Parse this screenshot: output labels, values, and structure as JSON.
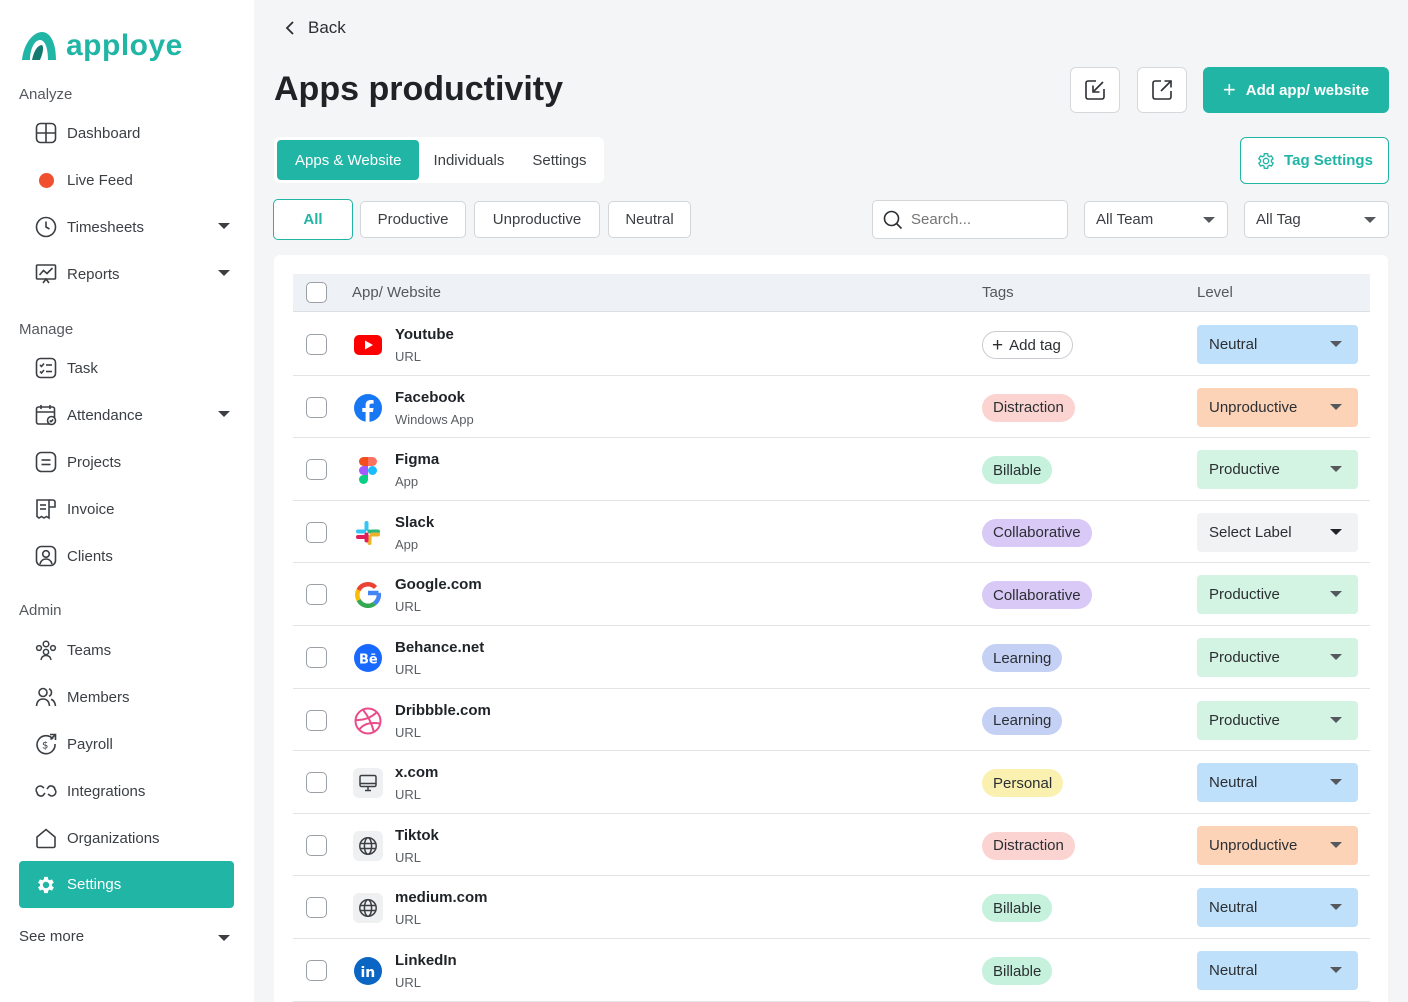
{
  "brand": {
    "name": "apploye",
    "color": "#21b5a6"
  },
  "sidebar": {
    "sections": {
      "analyze": "Analyze",
      "manage": "Manage",
      "admin": "Admin"
    },
    "items": [
      {
        "label": "Dashboard",
        "icon": "dashboard-icon"
      },
      {
        "label": "Live Feed",
        "icon": "live-dot"
      },
      {
        "label": "Timesheets",
        "icon": "clock-icon"
      },
      {
        "label": "Reports",
        "icon": "reports-icon"
      },
      {
        "label": "Task",
        "icon": "task-icon"
      },
      {
        "label": "Attendance",
        "icon": "calendar-icon"
      },
      {
        "label": "Projects",
        "icon": "projects-icon"
      },
      {
        "label": "Invoice",
        "icon": "invoice-icon"
      },
      {
        "label": "Clients",
        "icon": "clients-icon"
      },
      {
        "label": "Teams",
        "icon": "teams-icon"
      },
      {
        "label": "Members",
        "icon": "members-icon"
      },
      {
        "label": "Payroll",
        "icon": "payroll-icon"
      },
      {
        "label": "Integrations",
        "icon": "integrations-icon"
      },
      {
        "label": "Organizations",
        "icon": "home-icon"
      },
      {
        "label": "Settings",
        "icon": "gear-icon"
      }
    ],
    "see_more": "See more"
  },
  "header": {
    "back": "Back",
    "title": "Apps productivity",
    "add_button": "Add app/ website",
    "tag_settings": "Tag Settings"
  },
  "tabs": [
    "Apps & Website",
    "Individuals",
    "Settings"
  ],
  "filters": [
    "All",
    "Productive",
    "Unproductive",
    "Neutral"
  ],
  "search": {
    "placeholder": "Search..."
  },
  "selects": {
    "team": "All Team",
    "tag": "All Tag"
  },
  "table": {
    "headers": {
      "app": "App/ Website",
      "tags": "Tags",
      "level": "Level"
    },
    "add_tag": "Add tag",
    "rows": [
      {
        "name": "Youtube",
        "type": "URL",
        "icon": "youtube-icon",
        "tag": "",
        "level": "Neutral"
      },
      {
        "name": "Facebook",
        "type": "Windows App",
        "icon": "facebook-icon",
        "tag": "Distraction",
        "level": "Unproductive"
      },
      {
        "name": "Figma",
        "type": "App",
        "icon": "figma-icon",
        "tag": "Billable",
        "level": "Productive"
      },
      {
        "name": "Slack",
        "type": "App",
        "icon": "slack-icon",
        "tag": "Collaborative",
        "level": "Select Label"
      },
      {
        "name": "Google.com",
        "type": "URL",
        "icon": "google-icon",
        "tag": "Collaborative",
        "level": "Productive"
      },
      {
        "name": "Behance.net",
        "type": "URL",
        "icon": "behance-icon",
        "tag": "Learning",
        "level": "Productive"
      },
      {
        "name": "Dribbble.com",
        "type": "URL",
        "icon": "dribbble-icon",
        "tag": "Learning",
        "level": "Productive"
      },
      {
        "name": "x.com",
        "type": "URL",
        "icon": "monitor-icon",
        "tag": "Personal",
        "level": "Neutral"
      },
      {
        "name": "Tiktok",
        "type": "URL",
        "icon": "globe-icon",
        "tag": "Distraction",
        "level": "Unproductive"
      },
      {
        "name": "medium.com",
        "type": "URL",
        "icon": "globe-icon",
        "tag": "Billable",
        "level": "Neutral"
      },
      {
        "name": "LinkedIn",
        "type": "URL",
        "icon": "linkedin-icon",
        "tag": "Billable",
        "level": "Neutral"
      }
    ]
  },
  "colors": {
    "tags": {
      "Distraction": "#fbd3d0",
      "Billable": "#c5f1dd",
      "Collaborative": "#d9c9f7",
      "Learning": "#c4d1f5",
      "Personal": "#faf0b0"
    },
    "levels": {
      "Neutral": "#bfe0fb",
      "Unproductive": "#fdd3b8",
      "Productive": "#d3f4e3",
      "Select Label": "#f0f2f4"
    }
  }
}
